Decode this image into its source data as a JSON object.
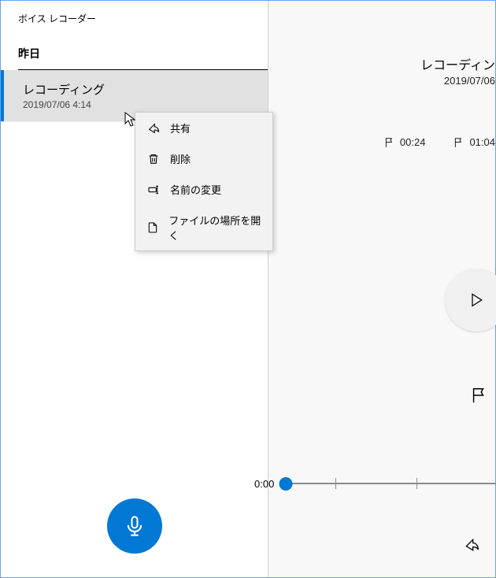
{
  "app_title": "ボイス レコーダー",
  "section_title": "昨日",
  "recordings": [
    {
      "title": "レコーディング",
      "date": "2019/07/06 4:14"
    }
  ],
  "context_menu": {
    "share": "共有",
    "delete": "削除",
    "rename": "名前の変更",
    "open_location": "ファイルの場所を開く"
  },
  "right_panel": {
    "title": "レコーディン",
    "date": "2019/07/06"
  },
  "markers": [
    {
      "time": "00:24"
    },
    {
      "time": "01:04"
    }
  ],
  "timeline": {
    "current": "0:00"
  }
}
